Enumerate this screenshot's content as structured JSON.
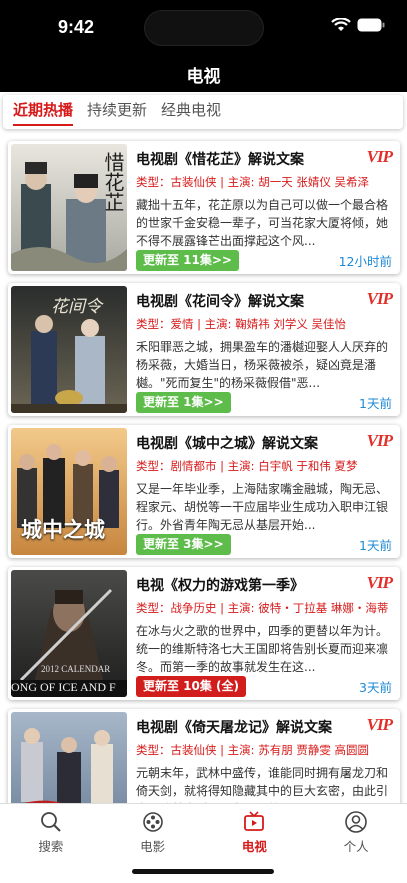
{
  "status": {
    "time": "9:42"
  },
  "header": {
    "title": "电视"
  },
  "tabs": [
    {
      "label": "近期热播",
      "active": true
    },
    {
      "label": "持续更新",
      "active": false
    },
    {
      "label": "经典电视",
      "active": false
    }
  ],
  "items": [
    {
      "title": "电视剧《惜花芷》解说文案",
      "vip": "VIP",
      "meta": "类型：古装仙侠 | 主演: 胡一天 张婧仪 吴希泽",
      "desc": "藏拙十五年，花芷原以为自己可以做一个最合格的世家千金安稳一辈子，可当花家大厦将倾，她不得不展露锋芒出面撑起这个风...",
      "badge": "更新至 11集>>",
      "badge_color": "green",
      "time": "12小时前",
      "poster_text": "惜花芷"
    },
    {
      "title": "电视剧《花间令》解说文案",
      "vip": "VIP",
      "meta": "类型：爱情 | 主演: 鞠婧祎 刘学义 吴佳怡",
      "desc": "禾阳罪恶之城，拥果盈车的潘樾迎娶人人厌弃的杨采薇，大婚当日，杨采薇被杀，疑凶竟是潘樾。\"死而复生\"的杨采薇假借\"恶...",
      "badge": "更新至 1集>>",
      "badge_color": "green",
      "time": "1天前",
      "poster_text": "花间令"
    },
    {
      "title": "电视剧《城中之城》解说文案",
      "vip": "VIP",
      "meta": "类型：剧情都市 | 主演: 白宇帆 于和伟 夏梦",
      "desc": "又是一年毕业季，上海陆家嘴金融城，陶无忌、程家元、胡悦等一干应届毕业生成功入职申江银行。外省青年陶无忌从基层开始...",
      "badge": "更新至 3集>>",
      "badge_color": "green",
      "time": "1天前",
      "poster_text": "城中之城"
    },
    {
      "title": "电视《权力的游戏第一季》",
      "vip": "VIP",
      "meta": "类型：战争历史 | 主演: 彼特・丁拉基 琳娜・海蒂",
      "desc": "在冰与火之歌的世界中，四季的更替以年为计。统一的维斯特洛七大王国即将告别长夏而迎来凛冬。而第一季的故事就发生在这...",
      "badge": "更新至 10集 (全)",
      "badge_color": "red",
      "time": "3天前",
      "poster_text": "2012 CALENDAR",
      "poster_text2": "ONG OF ICE AND F"
    },
    {
      "title": "电视剧《倚天屠龙记》解说文案",
      "vip": "VIP",
      "meta": "类型：古装仙侠 | 主演: 苏有朋 贾静雯 高圆圆",
      "desc": "元朝末年，武林中盛传，谁能同时拥有屠龙刀和倚天剑，就将得知隐藏其中的巨大玄密，由此引发了武林中对于屠龙刀和倚天...",
      "badge": "",
      "badge_color": "green",
      "time": "",
      "poster_text": ""
    }
  ],
  "nav": [
    {
      "label": "搜索",
      "icon": "search-icon",
      "active": false
    },
    {
      "label": "电影",
      "icon": "film-reel-icon",
      "active": false
    },
    {
      "label": "电视",
      "icon": "tv-icon",
      "active": true
    },
    {
      "label": "个人",
      "icon": "user-icon",
      "active": false
    }
  ],
  "colors": {
    "accent": "#d61a1a",
    "green_badge": "#5ebc4a",
    "time_blue": "#1d8ad6"
  }
}
